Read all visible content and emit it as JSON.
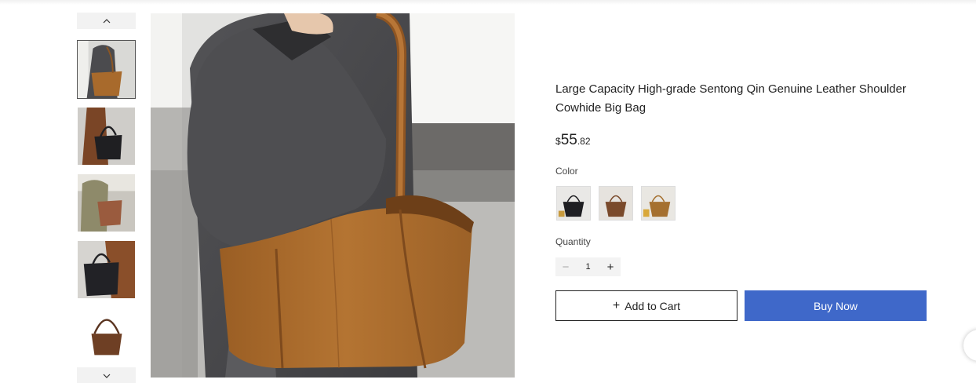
{
  "product": {
    "title": "Large Capacity High-grade Sentong Qin Genuine Leather Shoulder Cowhide Big Bag",
    "price": {
      "currency": "$",
      "integer": "55",
      "decimal": ".82"
    },
    "color_label": "Color",
    "quantity_label": "Quantity",
    "quantity_value": "1",
    "quantity_minus": "−",
    "quantity_plus": "+",
    "add_to_cart_label": "Add to Cart",
    "add_to_cart_icon": "+",
    "buy_now_label": "Buy Now",
    "swatches": [
      {
        "name": "black",
        "color": "#1e1e22"
      },
      {
        "name": "brown",
        "color": "#7a4a2b"
      },
      {
        "name": "tan",
        "color": "#a5702f"
      }
    ]
  },
  "gallery": {
    "thumbnails": 5,
    "active_index": 0
  },
  "colors": {
    "accent": "#3f68c9",
    "leather_tan": "#ad6e2e",
    "coat_gray": "#4a4a4c"
  }
}
